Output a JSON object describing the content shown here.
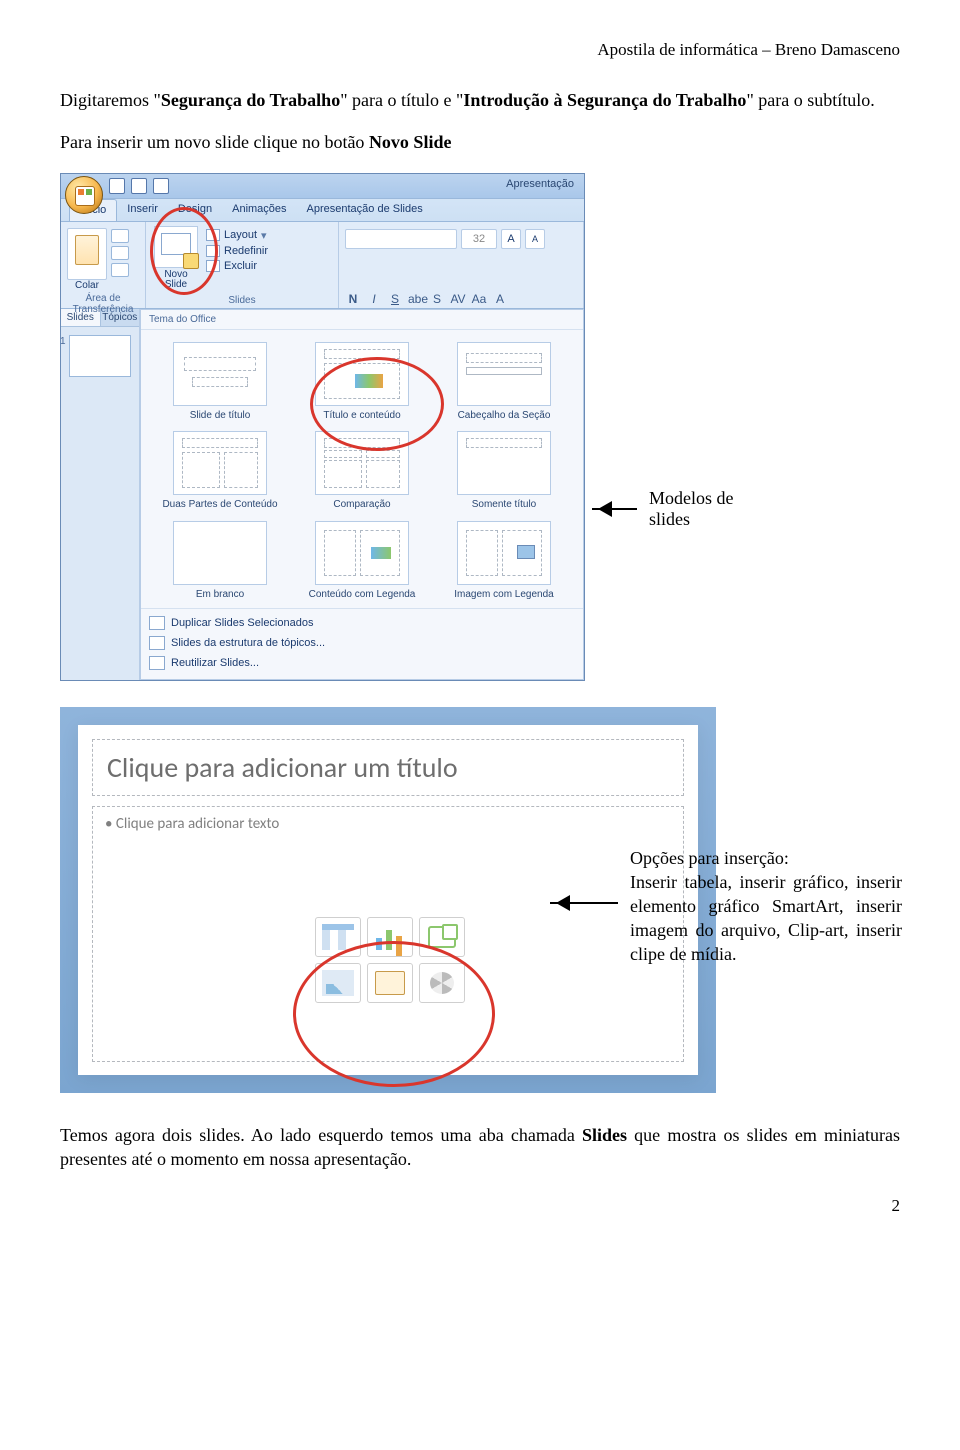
{
  "doc_header": "Apostila de informática – Breno Damasceno",
  "para1_prefix": "Digitaremos \"",
  "para1_seg1": "Segurança do Trabalho",
  "para1_mid": "\" para o título e \"",
  "para1_seg2": "Introdução à Segurança do Trabalho",
  "para1_suffix": "\" para o subtítulo.",
  "para2_prefix": "Para inserir um novo slide clique no botão ",
  "para2_bold": "Novo Slide",
  "arrow1_label": "Modelos de slides",
  "powerpoint": {
    "title_text": "Apresentação",
    "tabs": [
      "Início",
      "Inserir",
      "Design",
      "Animações",
      "Apresentação de Slides"
    ],
    "group_clipboard": "Área de Transferência",
    "btn_colar": "Colar",
    "btn_novo_slide": "Novo\nSlide",
    "group_slides": "Slides",
    "layout_items": [
      "Layout",
      "Redefinir",
      "Excluir"
    ],
    "side_tabs": [
      "Slides",
      "Tópicos"
    ],
    "gallery_header": "Tema do Office",
    "gallery": [
      {
        "key": "title",
        "label": "Slide de título"
      },
      {
        "key": "content",
        "label": "Título e conteúdo"
      },
      {
        "key": "header",
        "label": "Cabeçalho da Seção"
      },
      {
        "key": "two",
        "label": "Duas Partes de Conteúdo"
      },
      {
        "key": "cmp",
        "label": "Comparação"
      },
      {
        "key": "tonly",
        "label": "Somente título"
      },
      {
        "key": "blank",
        "label": "Em branco"
      },
      {
        "key": "capcontent",
        "label": "Conteúdo com Legenda"
      },
      {
        "key": "capimg",
        "label": "Imagem com Legenda"
      }
    ],
    "footer_opts": [
      "Duplicar Slides Selecionados",
      "Slides da estrutura de tópicos...",
      "Reutilizar Slides..."
    ],
    "font_buttons": [
      "N",
      "I",
      "S",
      "abe",
      "S",
      "AV",
      "Aa",
      "A"
    ],
    "font_size": "32"
  },
  "slide2": {
    "title_placeholder": "Clique para adicionar um título",
    "text_placeholder": "Clique para adicionar texto",
    "caption_title": "Opções para inserção:",
    "caption_body": "Inserir tabela, inserir gráfico, inserir elemento gráfico SmartArt, inserir imagem do arquivo, Clip-art, inserir clipe de mídia."
  },
  "para3_prefix": "Temos agora dois slides. Ao lado esquerdo temos uma aba chamada ",
  "para3_bold": "Slides",
  "para3_suffix": " que mostra os slides em miniaturas presentes até o momento em nossa apresentação.",
  "page_number": "2"
}
